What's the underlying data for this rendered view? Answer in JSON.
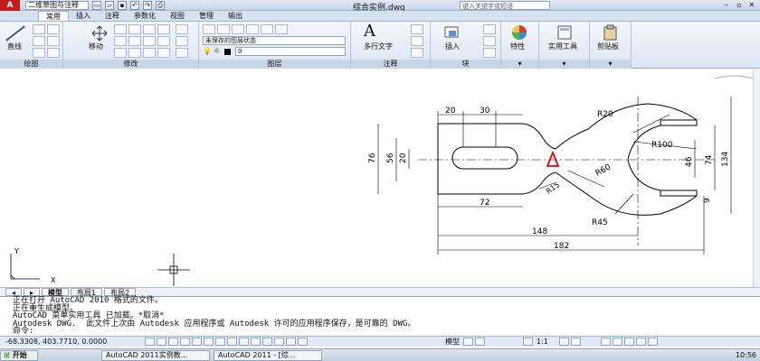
{
  "app": {
    "logo": "A",
    "workspace": "二维草图与注释",
    "title": "综合实例.dwg",
    "search_placeholder": "键入关键字或短语"
  },
  "ribbon_tabs": [
    "常用",
    "插入",
    "注释",
    "参数化",
    "视图",
    "管理",
    "输出"
  ],
  "panels": {
    "draw": {
      "title": "绘图",
      "line_label": "直线"
    },
    "modify": {
      "title": "修改",
      "move_label": "移动"
    },
    "layers": {
      "title": "图层",
      "state": "未保存的图层状态",
      "layer_name": "0"
    },
    "annotation": {
      "title": "注释",
      "mtext_label": "多行文字"
    },
    "block": {
      "title": "块",
      "insert_label": "插入"
    },
    "properties": {
      "label": "特性"
    },
    "utilities": {
      "label": "实用工具"
    },
    "clipboard": {
      "label": "剪贴板"
    }
  },
  "drawing": {
    "dimensions": {
      "d20": "20",
      "d30": "30",
      "r20": "R20",
      "r100": "R100",
      "r60": "R60",
      "r15": "R15",
      "r45": "R45",
      "d76": "76",
      "d56": "56",
      "d20v": "20",
      "d46": "46",
      "d74": "74",
      "d134": "134",
      "d9": "9",
      "d72": "72",
      "d148": "148",
      "d182": "182"
    },
    "ucs": {
      "x": "X",
      "y": "Y"
    }
  },
  "layout_tabs": [
    "模型",
    "布局1",
    "布局2"
  ],
  "command_lines": [
    "正在打开 AutoCAD 2010 格式的文件。",
    "正在重生成模型。",
    "AutoCAD 菜单实用工具 已加载。*取消*",
    "Autodesk DWG.  此文件上次由 Autodesk 应用程序或 Autodesk 许可的应用程序保存，是可靠的 DWG。",
    "命令:"
  ],
  "status": {
    "coords": "-68.3308, 403.7710, 0.0000",
    "model": "模型",
    "scale": "1:1"
  },
  "taskbar": {
    "start": "开始",
    "tasks": [
      "AutoCAD 2011实例教...",
      "AutoCAD 2011 - [综..."
    ],
    "clock": "10:56"
  }
}
